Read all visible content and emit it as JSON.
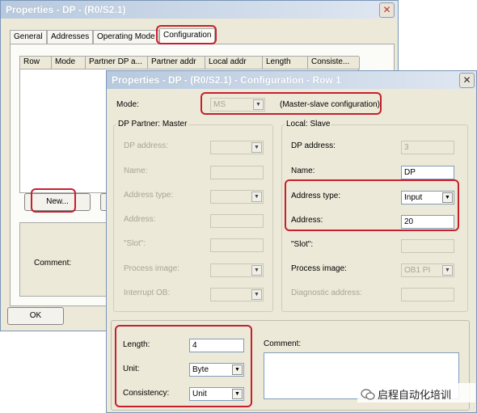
{
  "outer": {
    "title": "Properties - DP - (R0/S2.1)",
    "tabs": [
      "General",
      "Addresses",
      "Operating Mode",
      "Configuration"
    ],
    "columns": [
      "Row",
      "Mode",
      "Partner DP a...",
      "Partner addr",
      "Local addr",
      "Length",
      "Consiste..."
    ],
    "new_button": "New...",
    "comment_label": "Comment:",
    "ok_button": "OK"
  },
  "dialog": {
    "title": "Properties - DP - (R0/S2.1) - Configuration - Row 1",
    "mode_label": "Mode:",
    "mode_value": "MS",
    "mode_desc": "(Master-slave configuration)",
    "partner_group": "DP Partner: Master",
    "partner": {
      "dp_address": "DP address:",
      "name": "Name:",
      "address_type": "Address type:",
      "address": "Address:",
      "slot": "\"Slot\":",
      "process_image": "Process image:",
      "interrupt_ob": "Interrupt OB:"
    },
    "local_group": "Local: Slave",
    "local": {
      "dp_address_label": "DP address:",
      "dp_address_value": "3",
      "name_label": "Name:",
      "name_value": "DP",
      "address_type_label": "Address type:",
      "address_type_value": "Input",
      "address_label": "Address:",
      "address_value": "20",
      "slot_label": "\"Slot\":",
      "process_image_label": "Process image:",
      "process_image_value": "OB1 PI",
      "diag_label": "Diagnostic address:"
    },
    "length_label": "Length:",
    "length_value": "4",
    "unit_label": "Unit:",
    "unit_value": "Byte",
    "consistency_label": "Consistency:",
    "consistency_value": "Unit",
    "comment_label": "Comment:"
  },
  "watermark": "启程自动化培训",
  "colors": {
    "highlight": "#c6202d",
    "window": "#ece9d8"
  }
}
